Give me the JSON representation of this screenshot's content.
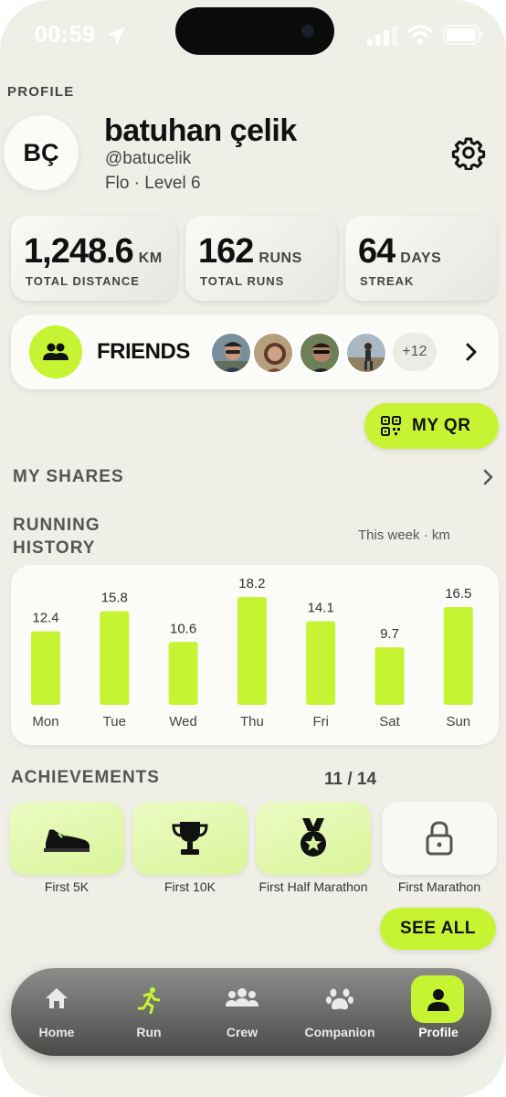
{
  "status": {
    "time": "00:59"
  },
  "header": {
    "section_label": "PROFILE"
  },
  "user": {
    "initials": "BÇ",
    "name": "batuhan çelik",
    "handle": "@batucelik",
    "level": "Flo · Level 6"
  },
  "stats": [
    {
      "value": "1,248.6",
      "unit": "KM",
      "label": "TOTAL DISTANCE"
    },
    {
      "value": "162",
      "unit": "RUNS",
      "label": "TOTAL RUNS"
    },
    {
      "value": "64",
      "unit": "DAYS",
      "label": "STREAK"
    }
  ],
  "friends": {
    "label": "FRIENDS",
    "extra_count": "+12"
  },
  "qr": {
    "label": "MY QR"
  },
  "shares": {
    "label": "MY SHARES"
  },
  "history": {
    "title_line1": "RUNNING",
    "title_line2": "HISTORY",
    "subtitle": "This week · km"
  },
  "chart_data": {
    "type": "bar",
    "categories": [
      "Mon",
      "Tue",
      "Wed",
      "Thu",
      "Fri",
      "Sat",
      "Sun"
    ],
    "values": [
      12.4,
      15.8,
      10.6,
      18.2,
      14.1,
      9.7,
      16.5
    ],
    "data_labels": [
      "12.4",
      "15.8",
      "10.6",
      "18.2",
      "14.1",
      "9.7",
      "16.5"
    ],
    "bar_color": "#c6f432",
    "grid": false
  },
  "achievements": {
    "title": "ACHIEVEMENTS",
    "count": "11 / 14",
    "items": [
      {
        "label": "First 5K",
        "icon": "running-shoe-icon",
        "locked": false
      },
      {
        "label": "First 10K",
        "icon": "trophy-icon",
        "locked": false
      },
      {
        "label": "First Half Marathon",
        "icon": "medal-icon",
        "locked": false
      },
      {
        "label": "First Marathon",
        "icon": "lock-icon",
        "locked": true
      }
    ],
    "see_all": "SEE ALL"
  },
  "tabs": [
    {
      "label": "Home",
      "icon": "home-icon",
      "active": false
    },
    {
      "label": "Run",
      "icon": "runner-icon",
      "active": false
    },
    {
      "label": "Crew",
      "icon": "crew-icon",
      "active": false
    },
    {
      "label": "Companion",
      "icon": "paw-icon",
      "active": false
    },
    {
      "label": "Profile",
      "icon": "person-icon",
      "active": true
    }
  ],
  "colors": {
    "accent": "#c6f432",
    "background": "#efeee7"
  }
}
